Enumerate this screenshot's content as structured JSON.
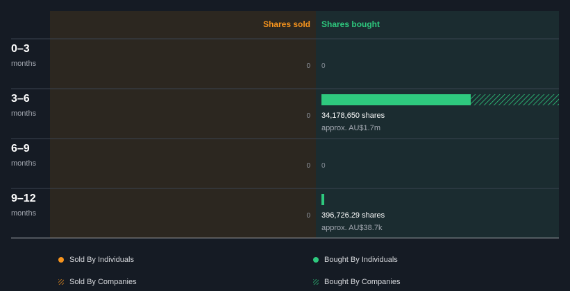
{
  "colors": {
    "background": "#151b24",
    "sold_panel": "#2c2720",
    "bought_panel": "#1b2c30",
    "sold_accent": "#f7941d",
    "bought_accent": "#2ec97e",
    "grid_line": "#3a4350",
    "axis_line": "#b8bcc2",
    "muted_text": "#8d939c"
  },
  "chart_data": {
    "type": "bar",
    "headers": {
      "sold": "Shares sold",
      "bought": "Shares bought"
    },
    "rows": [
      {
        "range": "0–3",
        "unit": "months",
        "sold_label": "0",
        "bought": 0,
        "bought_individuals": 0,
        "bought_label": "0",
        "bought_value": ""
      },
      {
        "range": "3–6",
        "unit": "months",
        "sold_label": "0",
        "bought": 34178650,
        "bought_individuals": 21500000,
        "bought_label": "34,178,650 shares",
        "bought_value": "approx. AU$1.7m"
      },
      {
        "range": "6–9",
        "unit": "months",
        "sold_label": "0",
        "bought": 0,
        "bought_individuals": 0,
        "bought_label": "0",
        "bought_value": ""
      },
      {
        "range": "9–12",
        "unit": "months",
        "sold_label": "0",
        "bought": 396726.29,
        "bought_individuals": 396726.29,
        "bought_label": "396,726.29 shares",
        "bought_value": "approx. AU$38.7k"
      }
    ],
    "max_shares": 34178650,
    "legend": [
      {
        "label": "Sold By Individuals",
        "kind": "dot",
        "color": "#f7941d"
      },
      {
        "label": "Bought By Individuals",
        "kind": "dot",
        "color": "#2ec97e"
      },
      {
        "label": "Sold By Companies",
        "kind": "hatch",
        "color": "#f7941d"
      },
      {
        "label": "Bought By Companies",
        "kind": "hatch",
        "color": "#2ec97e"
      }
    ]
  }
}
